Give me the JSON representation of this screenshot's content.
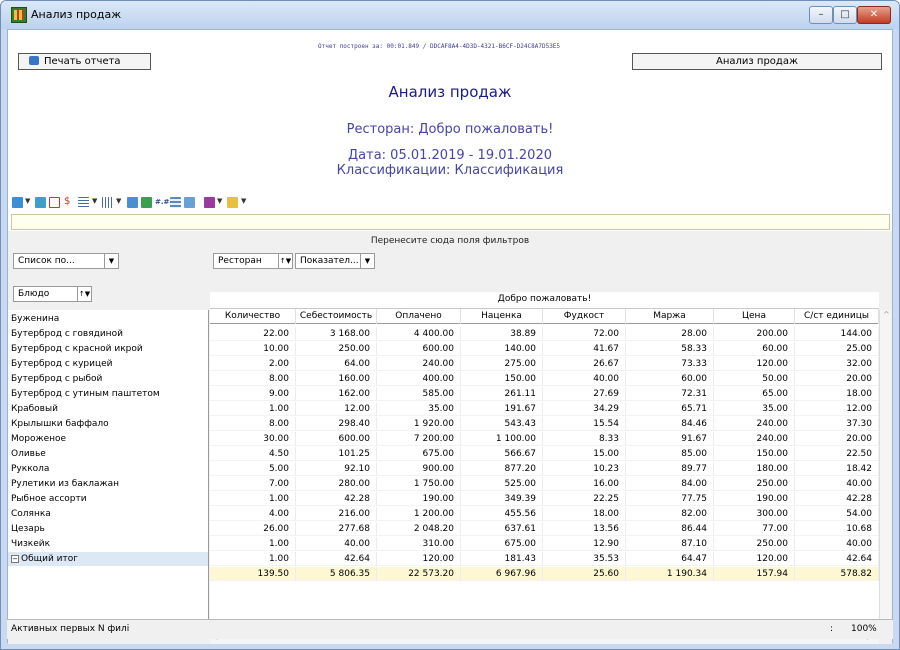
{
  "window": {
    "title": "Анализ продаж"
  },
  "report": {
    "print_label": "Печать отчета",
    "built": "Отчет построен за: 00:01.849 / DDCAF8A4-4D3D-4321-B6CF-D24C8A7D53E5",
    "analysis_label": "Анализ продаж",
    "title": "Анализ продаж",
    "restaurant": "Ресторан: Добро пожаловать!",
    "date": "Дата: 05.01.2019 - 19.01.2020",
    "classification": "Классификации: Классификация"
  },
  "grid": {
    "filter_hint": "Перенесите сюда поля фильтров",
    "list_chip": "Список по...",
    "restaurant_chip": "Ресторан",
    "indicator_chip": "Показател...",
    "dish_chip": "Блюдо",
    "cube_header": "Добро пожаловать!",
    "columns": [
      "Количество",
      "Себестоимость",
      "Оплачено",
      "Наценка",
      "Фудкост",
      "Маржа",
      "Цена",
      "С/ст единицы"
    ],
    "rows": [
      {
        "name": "Буженина",
        "values": [
          "22.00",
          "3 168.00",
          "4 400.00",
          "38.89",
          "72.00",
          "28.00",
          "200.00",
          "144.00"
        ]
      },
      {
        "name": "Бутерброд с говядиной",
        "values": [
          "10.00",
          "250.00",
          "600.00",
          "140.00",
          "41.67",
          "58.33",
          "60.00",
          "25.00"
        ]
      },
      {
        "name": "Бутерброд с красной икрой",
        "values": [
          "2.00",
          "64.00",
          "240.00",
          "275.00",
          "26.67",
          "73.33",
          "120.00",
          "32.00"
        ]
      },
      {
        "name": "Бутерброд с курицей",
        "values": [
          "8.00",
          "160.00",
          "400.00",
          "150.00",
          "40.00",
          "60.00",
          "50.00",
          "20.00"
        ]
      },
      {
        "name": "Бутерброд с рыбой",
        "values": [
          "9.00",
          "162.00",
          "585.00",
          "261.11",
          "27.69",
          "72.31",
          "65.00",
          "18.00"
        ]
      },
      {
        "name": "Бутерброд с утиным паштетом",
        "values": [
          "1.00",
          "12.00",
          "35.00",
          "191.67",
          "34.29",
          "65.71",
          "35.00",
          "12.00"
        ]
      },
      {
        "name": "Крабовый",
        "values": [
          "8.00",
          "298.40",
          "1 920.00",
          "543.43",
          "15.54",
          "84.46",
          "240.00",
          "37.30"
        ]
      },
      {
        "name": "Крылышки баффало",
        "values": [
          "30.00",
          "600.00",
          "7 200.00",
          "1 100.00",
          "8.33",
          "91.67",
          "240.00",
          "20.00"
        ]
      },
      {
        "name": "Мороженое",
        "values": [
          "4.50",
          "101.25",
          "675.00",
          "566.67",
          "15.00",
          "85.00",
          "150.00",
          "22.50"
        ]
      },
      {
        "name": "Оливье",
        "values": [
          "5.00",
          "92.10",
          "900.00",
          "877.20",
          "10.23",
          "89.77",
          "180.00",
          "18.42"
        ]
      },
      {
        "name": "Руккола",
        "values": [
          "7.00",
          "280.00",
          "1 750.00",
          "525.00",
          "16.00",
          "84.00",
          "250.00",
          "40.00"
        ]
      },
      {
        "name": "Рулетики из баклажан",
        "values": [
          "1.00",
          "42.28",
          "190.00",
          "349.39",
          "22.25",
          "77.75",
          "190.00",
          "42.28"
        ]
      },
      {
        "name": "Рыбное ассорти",
        "values": [
          "4.00",
          "216.00",
          "1 200.00",
          "455.56",
          "18.00",
          "82.00",
          "300.00",
          "54.00"
        ]
      },
      {
        "name": "Солянка",
        "values": [
          "26.00",
          "277.68",
          "2 048.20",
          "637.61",
          "13.56",
          "86.44",
          "77.00",
          "10.68"
        ]
      },
      {
        "name": "Цезарь",
        "values": [
          "1.00",
          "40.00",
          "310.00",
          "675.00",
          "12.90",
          "87.10",
          "250.00",
          "40.00"
        ]
      },
      {
        "name": "Чизкейк",
        "values": [
          "1.00",
          "42.64",
          "120.00",
          "181.43",
          "35.53",
          "64.47",
          "120.00",
          "42.64"
        ]
      }
    ],
    "total": {
      "name": "Общий итог",
      "values": [
        "139.50",
        "5 806.35",
        "22 573.20",
        "6 967.96",
        "25.60",
        "1 190.34",
        "157.94",
        "578.82"
      ]
    }
  },
  "status": {
    "filters": "Активных первых N филі",
    "separator": ":",
    "zoom": "100%"
  }
}
